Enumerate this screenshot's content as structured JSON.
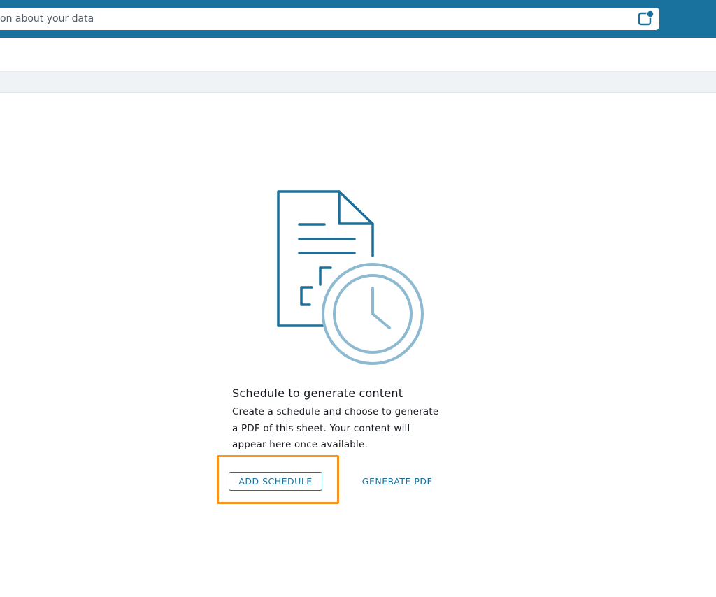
{
  "search": {
    "text": "on about your data"
  },
  "empty_state": {
    "title": "Schedule to generate content",
    "description": "Create a schedule and choose to generate a PDF of this sheet. Your content will appear here once available.",
    "add_schedule_label": "ADD SCHEDULE",
    "generate_pdf_label": "GENERATE PDF"
  },
  "colors": {
    "topbar": "#19719e",
    "accent": "#1b6f98",
    "highlight": "#f7941d",
    "clock_icon": "#8db9d1"
  },
  "icons": {
    "chat": "chat-bubble-icon",
    "illustration": "document-clock-icon"
  }
}
